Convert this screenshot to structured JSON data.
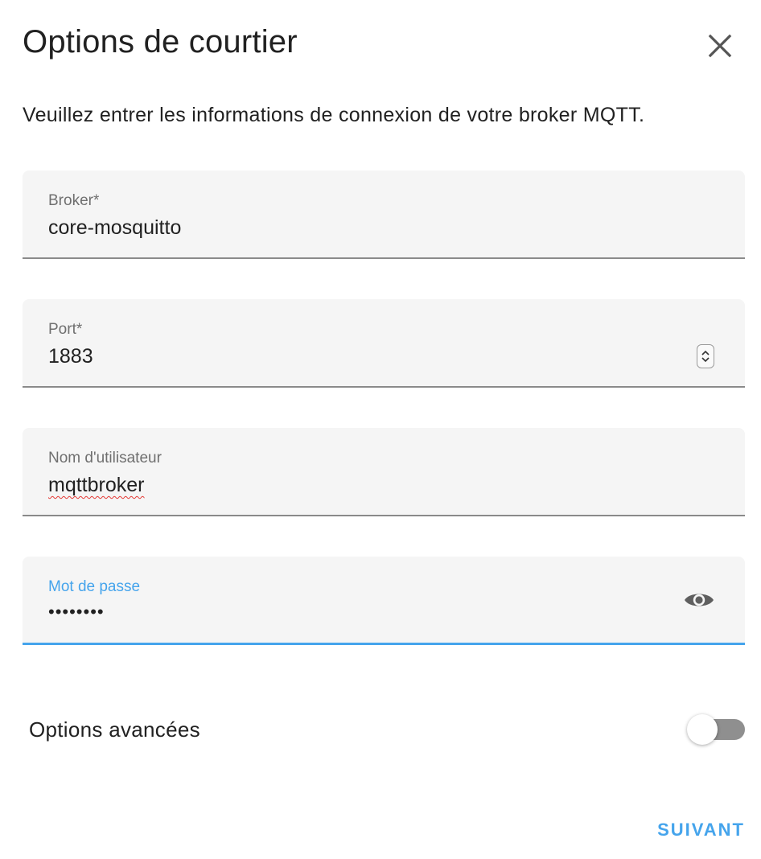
{
  "dialog": {
    "title": "Options de courtier",
    "description": "Veuillez entrer les informations de connexion de votre broker MQTT.",
    "close_icon": "close-icon"
  },
  "fields": {
    "broker": {
      "label": "Broker*",
      "value": "core-mosquitto"
    },
    "port": {
      "label": "Port*",
      "value": "1883",
      "icon": "number-spinner-icon"
    },
    "username": {
      "label": "Nom d'utilisateur",
      "value": "mqttbroker"
    },
    "password": {
      "label": "Mot de passe",
      "value": "••••••••",
      "icon": "eye-icon",
      "focused": true
    }
  },
  "advanced": {
    "label": "Options avancées",
    "enabled": false
  },
  "actions": {
    "next_label": "SUIVANT"
  },
  "colors": {
    "accent": "#45a4ec",
    "field_bg": "#f5f5f5",
    "text": "#212121",
    "label": "#6f6f6f",
    "toggle_track": "#8f8f8f"
  }
}
